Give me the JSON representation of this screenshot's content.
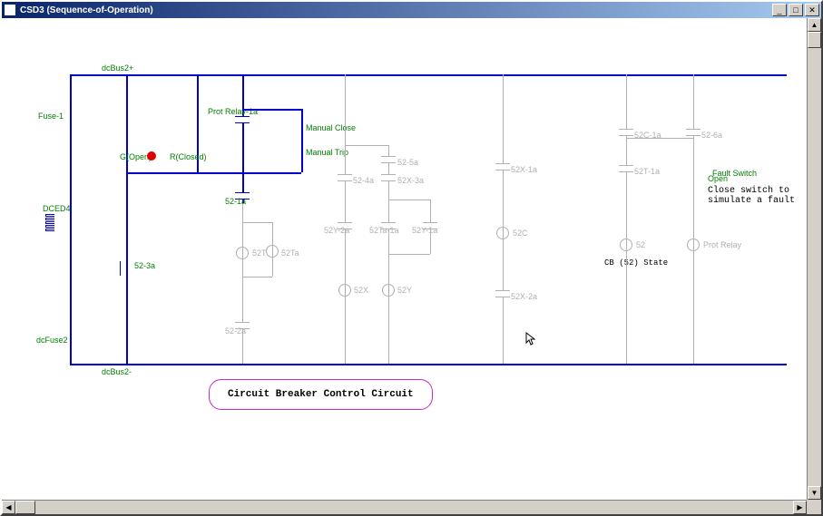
{
  "window": {
    "title": "CSD3 (Sequence-of-Operation)"
  },
  "buses": {
    "top": "dcBus2+",
    "bottom": "dcBus2-"
  },
  "left": {
    "fuse1": "Fuse-1",
    "dced": "DCED4",
    "dcfuse2": "dcFuse2"
  },
  "switches": {
    "g_open": "G(Open)",
    "r_closed": "R(Closed)"
  },
  "relays": {
    "prot1a": "Prot Relay-1a",
    "manual_close": "Manual Close",
    "manual_trip": "Manual Trip"
  },
  "contacts_blue": {
    "c52_3a": "52-3a",
    "c52_1a": "52-1a"
  },
  "contacts_gray": {
    "c52_4a": "52-4a",
    "c52_5a": "52-5a",
    "c52X_3a": "52X-3a",
    "c52T": "52T",
    "c52Ta": "52Ta",
    "c52Y_2a": "52Y-2a",
    "c52Ta_1a": "52Ta-1a",
    "c52Y_1a": "52Y-1a",
    "c52_2a": "52-2a",
    "c52X": "52X",
    "c52Y": "52Y",
    "c52X_1a": "52X-1a",
    "c52C": "52C",
    "c52X_2a": "52X-2a",
    "c52C_1a": "52C-1a",
    "c52T_1a": "52T-1a",
    "c52_6a": "52-6a",
    "c52": "52",
    "cProtRelay": "Prot Relay"
  },
  "cb_state": "CB (52) State",
  "fault": {
    "label1": "Fault Switch",
    "label2": "Open",
    "note": "Close switch to simulate a fault"
  },
  "caption": "Circuit Breaker Control Circuit"
}
